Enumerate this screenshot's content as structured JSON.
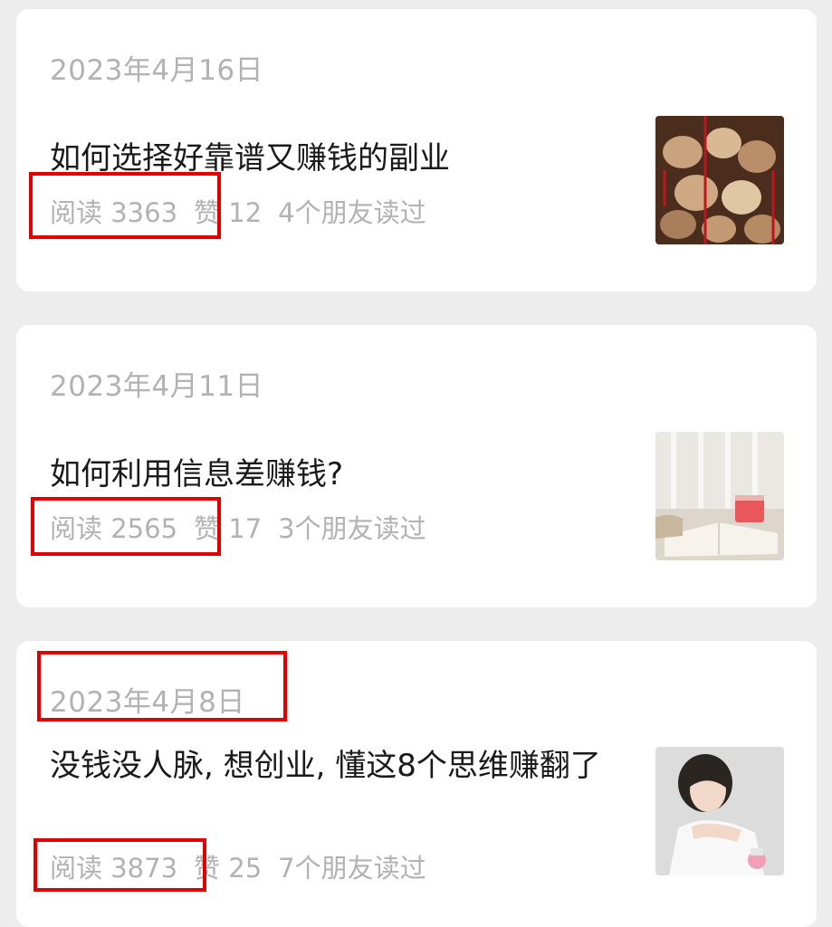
{
  "articles": [
    {
      "date": "2023年4月16日",
      "title": "如何选择好靠谱又赚钱的副业",
      "reads": "阅读 3363",
      "likes": "赞 12",
      "friends": "4个朋友读过",
      "thumb_icon": "wooden-wish-plaques-image"
    },
    {
      "date": "2023年4月11日",
      "title": "如何利用信息差赚钱?",
      "reads": "阅读 2565",
      "likes": "赞 17",
      "friends": "3个朋友读过",
      "thumb_icon": "book-and-tea-cup-image"
    },
    {
      "date": "2023年4月8日",
      "title": "没钱没人脉, 想创业, 懂这8个思维赚翻了",
      "reads": "阅读 3873",
      "likes": "赞 25",
      "friends": "7个朋友读过",
      "thumb_icon": "woman-portrait-image"
    }
  ],
  "colors": {
    "background": "#ededed",
    "card": "#ffffff",
    "meta_text": "#b2b2b2",
    "title_text": "#1a1a1a",
    "highlight": "#e10000"
  }
}
